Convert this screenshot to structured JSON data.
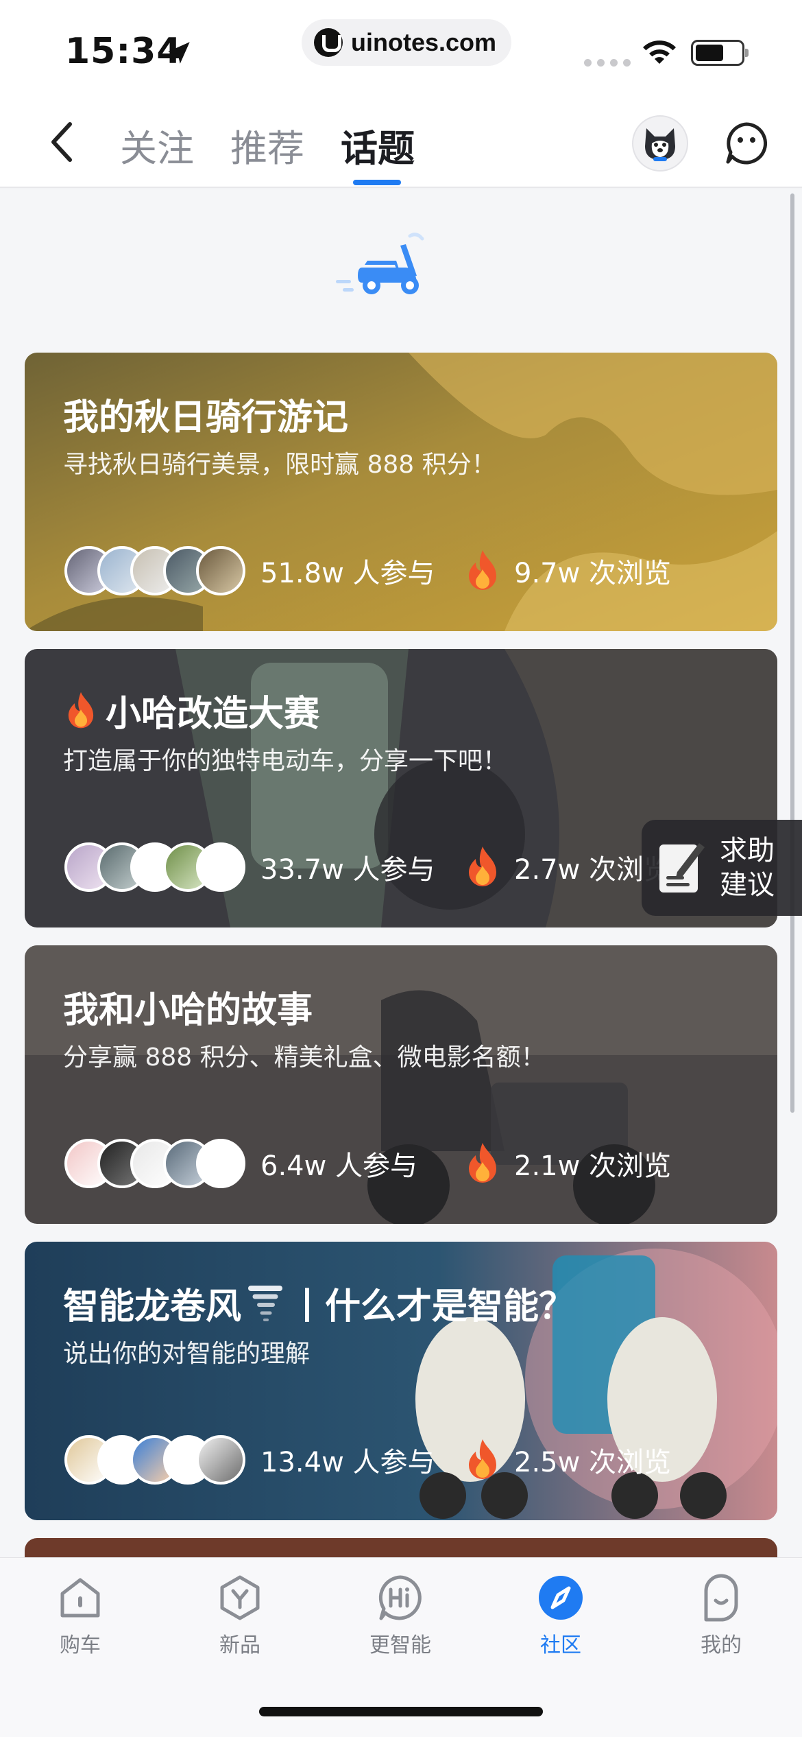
{
  "status_bar": {
    "time": "15:34",
    "url": "uinotes.com"
  },
  "nav": {
    "tabs": [
      {
        "label": "关注",
        "active": false
      },
      {
        "label": "推荐",
        "active": false
      },
      {
        "label": "话题",
        "active": true
      }
    ],
    "accent_color": "#1f7bf2"
  },
  "topics": [
    {
      "title": "我的秋日骑行游记",
      "subtitle": "寻找秋日骑行美景，限时赢 888 积分！",
      "participants": "51.8w 人参与",
      "views": "9.7w 次浏览",
      "has_fire_prefix": false,
      "bg_color": "#8a6f2a"
    },
    {
      "title": "小哈改造大赛",
      "subtitle": "打造属于你的独特电动车，分享一下吧！",
      "participants": "33.7w 人参与",
      "views": "2.7w 次浏览",
      "has_fire_prefix": true,
      "bg_color": "#3d3d42"
    },
    {
      "title": "我和小哈的故事",
      "subtitle": "分享赢 888 积分、精美礼盒、微电影名额！",
      "participants": "6.4w 人参与",
      "views": "2.1w 次浏览",
      "has_fire_prefix": false,
      "bg_color": "#4a4848"
    },
    {
      "title_before": "智能龙卷风",
      "title_after": "丨什么才是智能？",
      "subtitle": "说出你的对智能的理解",
      "participants": "13.4w 人参与",
      "views": "2.5w 次浏览",
      "has_fire_prefix": false,
      "bg_color": "#2a4a63"
    }
  ],
  "feedback": {
    "label": "求助建议"
  },
  "tabbar": {
    "items": [
      {
        "label": "购车",
        "icon": "house-icon",
        "active": false
      },
      {
        "label": "新品",
        "icon": "hexagon-y-icon",
        "active": false
      },
      {
        "label": "更智能",
        "icon": "hi-bubble-icon",
        "active": false
      },
      {
        "label": "社区",
        "icon": "compass-icon",
        "active": true
      },
      {
        "label": "我的",
        "icon": "face-icon",
        "active": false
      }
    ]
  }
}
